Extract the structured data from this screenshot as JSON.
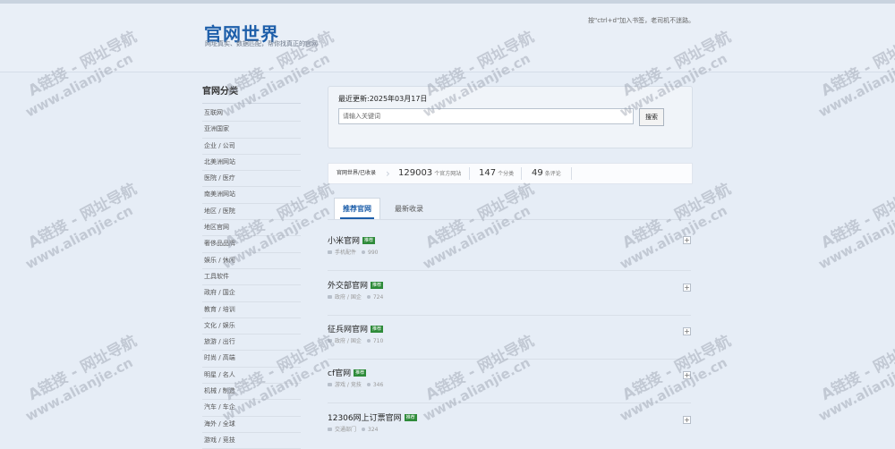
{
  "header": {
    "title": "官网世界",
    "subtitle": "网址真实、数据匹配，帮你找真正的官网",
    "hint": "按\"ctrl+d\"加入书签，老司机不迷路。"
  },
  "sidebar": {
    "title": "官网分类",
    "items": [
      "互联网",
      "亚洲国家",
      "企业 / 公司",
      "北美洲网站",
      "医院 / 医疗",
      "南美洲网站",
      "地区 / 医院",
      "地区官网",
      "奢侈品品牌",
      "娱乐 / 休闲",
      "工具软件",
      "政府 / 国企",
      "教育 / 培训",
      "文化 / 娱乐",
      "旅游 / 出行",
      "时尚 / 高端",
      "明星 / 名人",
      "机械 / 制造",
      "汽车 / 车企",
      "海外 / 全球",
      "游戏 / 竞技"
    ]
  },
  "search": {
    "update": "最近更新:2025年03月17日",
    "placeholder": "请输入关键词",
    "button": "搜索"
  },
  "stats": {
    "crumb": "官网世界/已收录",
    "sites_num": "129003",
    "sites_label": "个官方网站",
    "cat_num": "147",
    "cat_label": "个分类",
    "comment_num": "49",
    "comment_label": "条评论"
  },
  "tabs": {
    "active": "推荐官网",
    "other": "最新收录"
  },
  "entries": [
    {
      "name": "小米官网",
      "badge": "推荐",
      "category": "手机配件",
      "count": "990"
    },
    {
      "name": "外交部官网",
      "badge": "推荐",
      "category": "政府 / 国企",
      "count": "724"
    },
    {
      "name": "征兵网官网",
      "badge": "推荐",
      "category": "政府 / 国企",
      "count": "710"
    },
    {
      "name": "cf官网",
      "badge": "推荐",
      "category": "游戏 / 竞技",
      "count": "346"
    },
    {
      "name": "12306网上订票官网",
      "badge": "推荐",
      "category": "交通部门",
      "count": "324"
    }
  ],
  "watermark": {
    "line1": "A链接 - 网址导航",
    "line2": "www.alianjie.cn"
  },
  "colors": {
    "accent": "#1e5faa",
    "badge": "#2e8b3a",
    "background": "#e6edf6"
  }
}
